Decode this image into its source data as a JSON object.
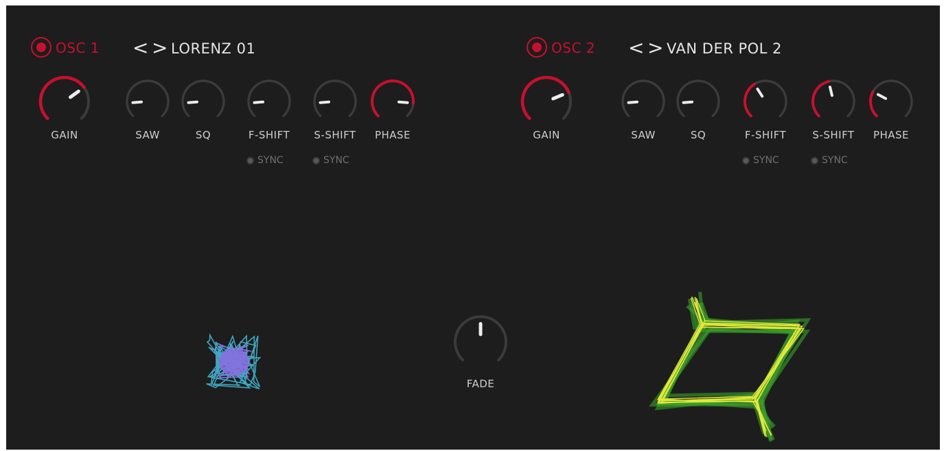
{
  "osc1": {
    "label": "OSC 1",
    "preset": "LORENZ 01",
    "knobs": [
      {
        "name": "gain",
        "label": "GAIN",
        "value": 0.7,
        "active": true
      },
      {
        "name": "saw",
        "label": "SAW",
        "value": 0.15,
        "active": false
      },
      {
        "name": "sq",
        "label": "SQ",
        "value": 0.15,
        "active": false
      },
      {
        "name": "f-shift",
        "label": "F-SHIFT",
        "value": 0.15,
        "active": false
      },
      {
        "name": "s-shift",
        "label": "S-SHIFT",
        "value": 0.15,
        "active": false
      },
      {
        "name": "phase",
        "label": "PHASE",
        "value": 0.85,
        "active": true
      }
    ],
    "sync": [
      "SYNC",
      "SYNC"
    ]
  },
  "osc2": {
    "label": "OSC 2",
    "preset": "VAN DER POL 2",
    "knobs": [
      {
        "name": "gain",
        "label": "GAIN",
        "value": 0.75,
        "active": true
      },
      {
        "name": "saw",
        "label": "SAW",
        "value": 0.15,
        "active": false
      },
      {
        "name": "sq",
        "label": "SQ",
        "value": 0.15,
        "active": false
      },
      {
        "name": "f-shift",
        "label": "F-SHIFT",
        "value": 0.38,
        "active": true
      },
      {
        "name": "s-shift",
        "label": "S-SHIFT",
        "value": 0.45,
        "active": true
      },
      {
        "name": "phase",
        "label": "PHASE",
        "value": 0.27,
        "active": true
      }
    ],
    "sync": [
      "SYNC",
      "SYNC"
    ]
  },
  "fade": {
    "label": "FADE",
    "value": 0.5
  },
  "colors": {
    "accent": "#c8102e",
    "track": "#3b3b3b",
    "pointer": "#ececec",
    "osc1_viz": "#8a6de0",
    "osc1_viz_alt": "#3fa7c0",
    "osc2_viz": "#e6e93a",
    "osc2_viz_alt": "#3aa12c"
  },
  "icons": {
    "power": "power-icon",
    "prev": "chevron-left-icon",
    "next": "chevron-right-icon"
  }
}
